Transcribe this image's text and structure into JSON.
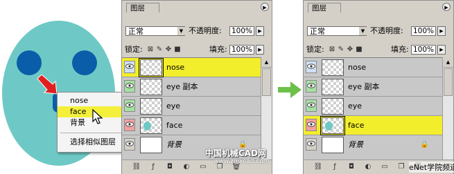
{
  "context_menu": {
    "items": [
      "nose",
      "face",
      "背景"
    ],
    "selected": "face",
    "extra_item": "选择相似图层"
  },
  "panels": [
    {
      "tab": "图层",
      "blend_mode": "正常",
      "opacity_label": "不透明度:",
      "opacity_value": "100%",
      "lock_label": "锁定:",
      "fill_label": "填充:",
      "fill_value": "100%",
      "layers": [
        {
          "name": "nose",
          "highlighted": true
        },
        {
          "name": "eye 副本",
          "highlighted": false
        },
        {
          "name": "eye",
          "highlighted": false
        },
        {
          "name": "face",
          "highlighted": false
        },
        {
          "name": "背景",
          "highlighted": false
        }
      ]
    },
    {
      "tab": "图层",
      "blend_mode": "正常",
      "opacity_label": "不透明度:",
      "opacity_value": "100%",
      "lock_label": "锁定:",
      "fill_label": "填充:",
      "fill_value": "100%",
      "layers": [
        {
          "name": "nose",
          "highlighted": false
        },
        {
          "name": "eye 副本",
          "highlighted": false
        },
        {
          "name": "eye",
          "highlighted": false
        },
        {
          "name": "face",
          "highlighted": true
        },
        {
          "name": "背景",
          "highlighted": false
        }
      ]
    }
  ],
  "watermark": {
    "line1": "中国机械CAD网",
    "line2": "www.zgjxcad.com",
    "corner": "eNet学院频道"
  },
  "colors": {
    "face": "#6ec9c6",
    "eyes_nose": "#0a5da8",
    "highlight": "#f2ee2c",
    "red_arrow": "#e02020",
    "green_arrow": "#6cc04a"
  }
}
